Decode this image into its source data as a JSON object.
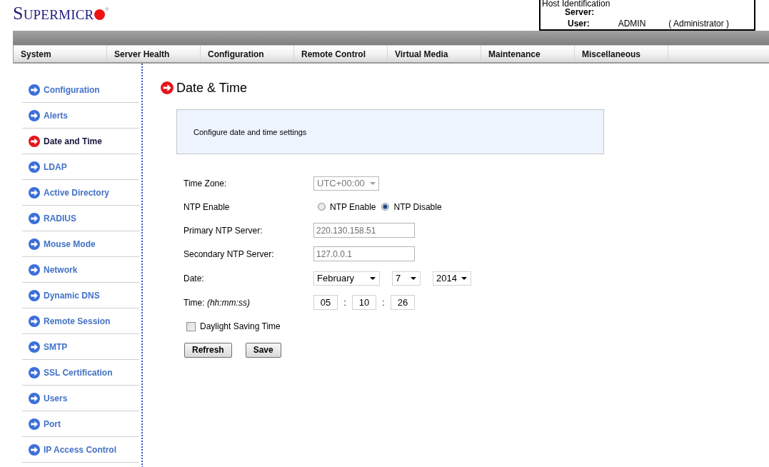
{
  "logo": {
    "text": "SUPERMICR",
    "mark": "®"
  },
  "host_identification": {
    "title": "Host Identification",
    "server_label": "Server:",
    "user_label": "User:",
    "user_name": "ADMIN",
    "user_role": "( Administrator )"
  },
  "menu": [
    {
      "label": "System"
    },
    {
      "label": "Server Health"
    },
    {
      "label": "Configuration"
    },
    {
      "label": "Remote Control"
    },
    {
      "label": "Virtual Media"
    },
    {
      "label": "Maintenance"
    },
    {
      "label": "Miscellaneous"
    }
  ],
  "sidebar": {
    "items": [
      {
        "label": "Configuration",
        "selected": false
      },
      {
        "label": "Alerts",
        "selected": false
      },
      {
        "label": "Date and Time",
        "selected": true
      },
      {
        "label": "LDAP",
        "selected": false
      },
      {
        "label": "Active Directory",
        "selected": false
      },
      {
        "label": "RADIUS",
        "selected": false
      },
      {
        "label": "Mouse Mode",
        "selected": false
      },
      {
        "label": "Network",
        "selected": false
      },
      {
        "label": "Dynamic DNS",
        "selected": false
      },
      {
        "label": "Remote Session",
        "selected": false
      },
      {
        "label": "SMTP",
        "selected": false
      },
      {
        "label": "SSL Certification",
        "selected": false
      },
      {
        "label": "Users",
        "selected": false
      },
      {
        "label": "Port",
        "selected": false
      },
      {
        "label": "IP Access Control",
        "selected": false
      }
    ]
  },
  "page": {
    "title": "Date & Time",
    "description": "Configure date and time settings"
  },
  "form": {
    "rows": [
      {
        "kind": "select",
        "label": "Time Zone:",
        "value": "UTC+00:00",
        "disabled": true
      },
      {
        "kind": "radio",
        "label": "NTP Enable",
        "options": [
          {
            "label": "NTP Enable",
            "selected": false
          },
          {
            "label": "NTP Disable",
            "selected": true
          }
        ]
      },
      {
        "kind": "text",
        "label": "Primary NTP Server:",
        "value": "220.130.158.51",
        "disabled": true
      },
      {
        "kind": "text",
        "label": "Secondary NTP Server:",
        "value": "127.0.0.1",
        "disabled": true
      },
      {
        "kind": "date",
        "label": "Date:",
        "parts": [
          "February",
          "7",
          "2014"
        ]
      },
      {
        "kind": "time",
        "label": "Time: *(hh:mm:ss)*",
        "parts": [
          "05",
          "10",
          "26"
        ],
        "separators": [
          ":",
          ":"
        ]
      }
    ],
    "daylight_saving": {
      "label": "Daylight Saving Time",
      "checked": false
    },
    "buttons": [
      "Refresh",
      "Save"
    ]
  }
}
